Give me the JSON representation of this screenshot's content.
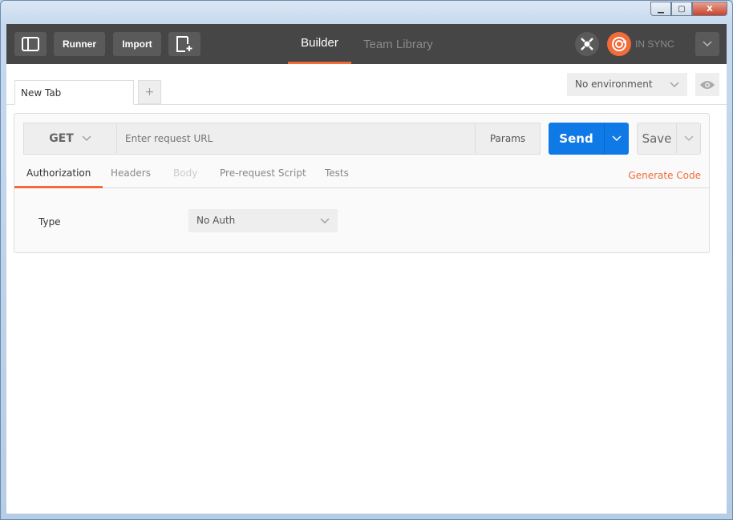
{
  "window": {
    "close_label": "X"
  },
  "toolbar": {
    "runner": "Runner",
    "import": "Import",
    "tabs": [
      {
        "label": "Builder",
        "active": true
      },
      {
        "label": "Team Library",
        "active": false
      }
    ],
    "sync_status": "IN SYNC"
  },
  "tabs": {
    "items": [
      {
        "label": "New Tab"
      }
    ],
    "add_label": "+"
  },
  "environment": {
    "selected": "No environment"
  },
  "request": {
    "method": "GET",
    "url_value": "",
    "url_placeholder": "Enter request URL",
    "params": "Params",
    "send": "Send",
    "save": "Save"
  },
  "request_tabs": {
    "items": [
      "Authorization",
      "Headers",
      "Body",
      "Pre-request Script",
      "Tests"
    ],
    "generate_code": "Generate Code"
  },
  "auth": {
    "type_label": "Type",
    "selected": "No Auth"
  },
  "colors": {
    "accent": "#f26b3a",
    "send": "#0f7ae5",
    "topbar": "#464646"
  }
}
